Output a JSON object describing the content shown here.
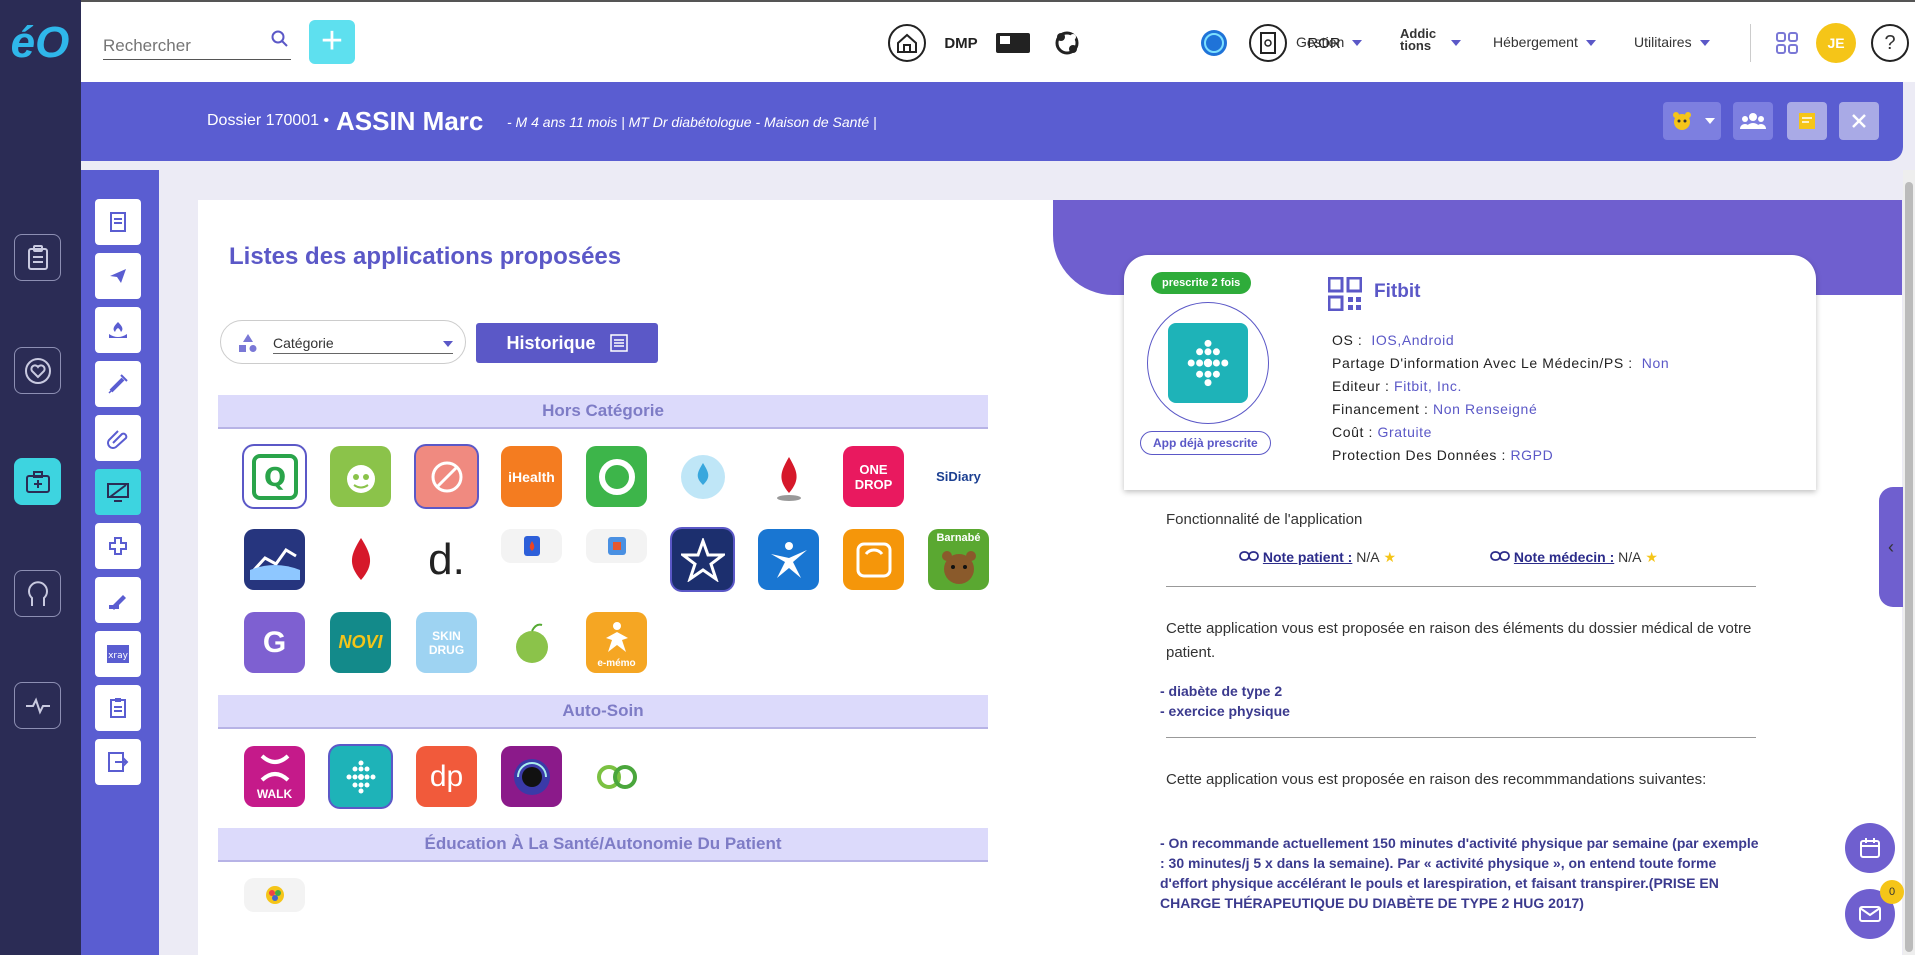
{
  "topbar": {
    "logo": "éO",
    "search_placeholder": "Rechercher",
    "dmp_label": "DMP",
    "ror_label": "ROR",
    "menus": [
      "Gestion",
      "Addic tions",
      "Hébergement",
      "Utilitaires"
    ],
    "avatar_initials": "JE",
    "help": "?"
  },
  "banner": {
    "dossier": "Dossier 170001 •",
    "name": "ASSIN Marc",
    "info": "- M 4 ans 11 mois | MT Dr diabétologue - Maison de Santé |"
  },
  "main": {
    "title": "Listes des applications proposées",
    "category_label": "Catégorie",
    "history_button": "Historique",
    "sections": [
      "Hors Catégorie",
      "Auto-Soin",
      "Éducation À La Santé/Autonomie Du Patient"
    ],
    "apps": {
      "ihealth": "iHealth",
      "onedrop": "ONE DROP",
      "sidiary": "SiDiary",
      "d": "d.",
      "barnabe": "Barnabé",
      "g": "G",
      "novi": "NOVI",
      "skindrug": "SKIN DRUG",
      "emento": "e-mémo",
      "walk": "WALK",
      "dp": "dp"
    }
  },
  "detail": {
    "badge": "prescrite 2 fois",
    "already_prescribed": "App déjà prescrite",
    "app_name": "Fitbit",
    "props": [
      {
        "label": "OS :",
        "value": "IOS,Android"
      },
      {
        "label": "Partage D'information Avec Le Médecin/PS :",
        "value": "Non"
      },
      {
        "label": "Editeur :",
        "value": "Fitbit, Inc."
      },
      {
        "label": "Financement :",
        "value": "Non Renseigné"
      },
      {
        "label": "Coût :",
        "value": "Gratuite"
      },
      {
        "label": "Protection Des Données :",
        "value": "RGPD"
      }
    ],
    "fonctionnalite": "Fonctionnalité de l'application",
    "note_patient_label": "Note patient :",
    "note_patient_value": "N/A",
    "note_medecin_label": "Note médecin :",
    "note_medecin_value": "N/A",
    "reason_1": "Cette application vous est proposée en raison des éléments du dossier médical de votre patient.",
    "items_1": [
      "- diabète de type 2",
      "- exercice physique"
    ],
    "reason_2": "Cette application vous est proposée en raison des recommmandations suivantes:",
    "recommendation": "- On recommande actuellement 150 minutes d'activité physique par semaine (par exemple : 30 minutes/j 5 x dans la semaine). Par « activité physique », on entend toute forme d'effort physique accélérant le pouls et larespiration, et faisant transpirer.(PRISE EN CHARGE THÉRAPEUTIQUE DU DIABÈTE DE TYPE 2 HUG 2017)"
  },
  "notifications": {
    "count": "0"
  },
  "colors": {
    "primary": "#5b58c7",
    "banner": "#5a5dd1",
    "accent": "#3dd4e0",
    "sidebar": "#2b2c55",
    "gold": "#f5c518",
    "green": "#2eac3a"
  }
}
